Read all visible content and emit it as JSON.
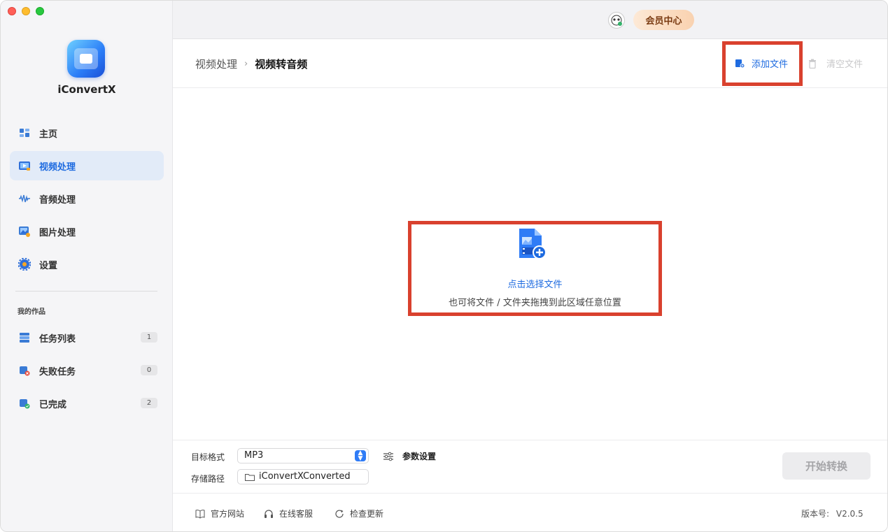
{
  "app": {
    "name": "iConvertX"
  },
  "topbar": {
    "vip_label": "会员中心"
  },
  "sidebar": {
    "items": [
      {
        "label": "主页"
      },
      {
        "label": "视频处理"
      },
      {
        "label": "音频处理"
      },
      {
        "label": "图片处理"
      },
      {
        "label": "设置"
      }
    ],
    "section_label": "我的作品",
    "works": [
      {
        "label": "任务列表",
        "count": "1"
      },
      {
        "label": "失败任务",
        "count": "0"
      },
      {
        "label": "已完成",
        "count": "2"
      }
    ]
  },
  "header": {
    "breadcrumb_parent": "视频处理",
    "breadcrumb_sep": "›",
    "breadcrumb_current": "视频转音频",
    "add_file_label": "添加文件",
    "clear_file_label": "清空文件"
  },
  "dropzone": {
    "title": "点击选择文件",
    "subtitle": "也可将文件 / 文件夹拖拽到此区域任意位置"
  },
  "settings": {
    "format_label": "目标格式",
    "format_value": "MP3",
    "params_label": "参数设置",
    "path_label": "存储路径",
    "path_value": "iConvertXConverted",
    "start_label": "开始转换"
  },
  "footer": {
    "website_label": "官方网站",
    "support_label": "在线客服",
    "update_label": "检查更新",
    "version_label": "版本号:",
    "version_value": "V2.0.5"
  },
  "colors": {
    "accent": "#1e6be0",
    "highlight_box": "#d9412e",
    "active_nav_bg": "#e2ebf8"
  }
}
